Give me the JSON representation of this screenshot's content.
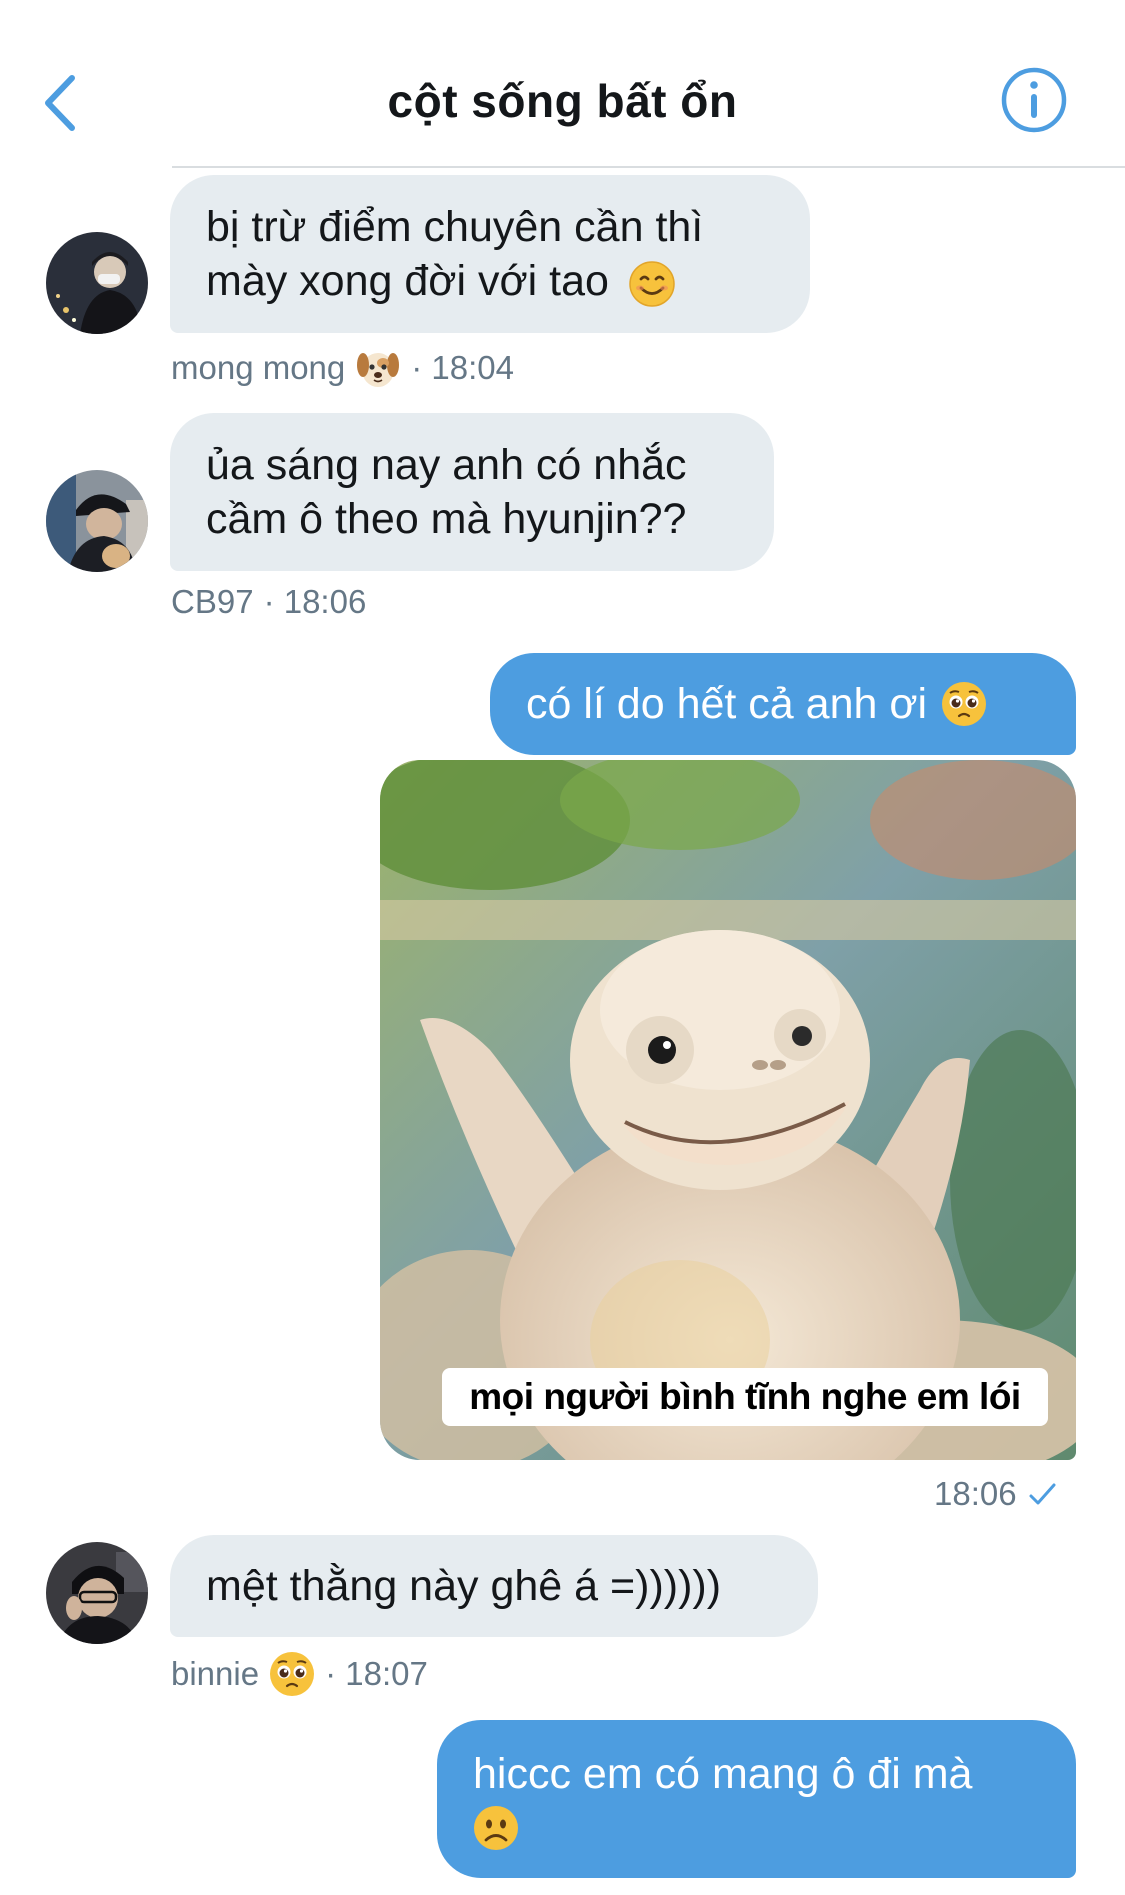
{
  "header": {
    "title": "cột sống bất ổn",
    "back_icon": "chevron-left-icon",
    "info_icon": "info-icon",
    "accent": "#4d9de0"
  },
  "colors": {
    "incoming_bubble": "#e6ecf0",
    "outgoing_bubble": "#4d9de0",
    "meta_text": "#657786"
  },
  "messages": [
    {
      "direction": "incoming",
      "text_line1": "bị trừ điểm chuyên cần thì",
      "text_line2": "mày xong đời với tao",
      "emoji": "smiling-face-icon",
      "sender": "mong mong",
      "sender_emoji": "dog-face-icon",
      "time": "· 18:04"
    },
    {
      "direction": "incoming",
      "text_line1": "ủa sáng nay anh có nhắc",
      "text_line2": "cầm ô theo mà hyunjin??",
      "sender": "CB97",
      "time": "· 18:06"
    },
    {
      "direction": "outgoing",
      "text": "có lí do hết cả anh ơi",
      "emoji": "pleading-face-icon"
    },
    {
      "direction": "outgoing",
      "type": "image",
      "image_caption": "mọi người bình tĩnh nghe em lói",
      "time": "18:06",
      "status_icon": "checkmark-icon"
    },
    {
      "direction": "incoming",
      "text": "mệt thằng này ghê á =))))))",
      "sender": "binnie",
      "sender_emoji": "pleading-face-icon",
      "time": "· 18:07"
    },
    {
      "direction": "outgoing",
      "text": "hiccc em có mang ô đi mà",
      "emoji": "frowning-face-icon"
    }
  ]
}
